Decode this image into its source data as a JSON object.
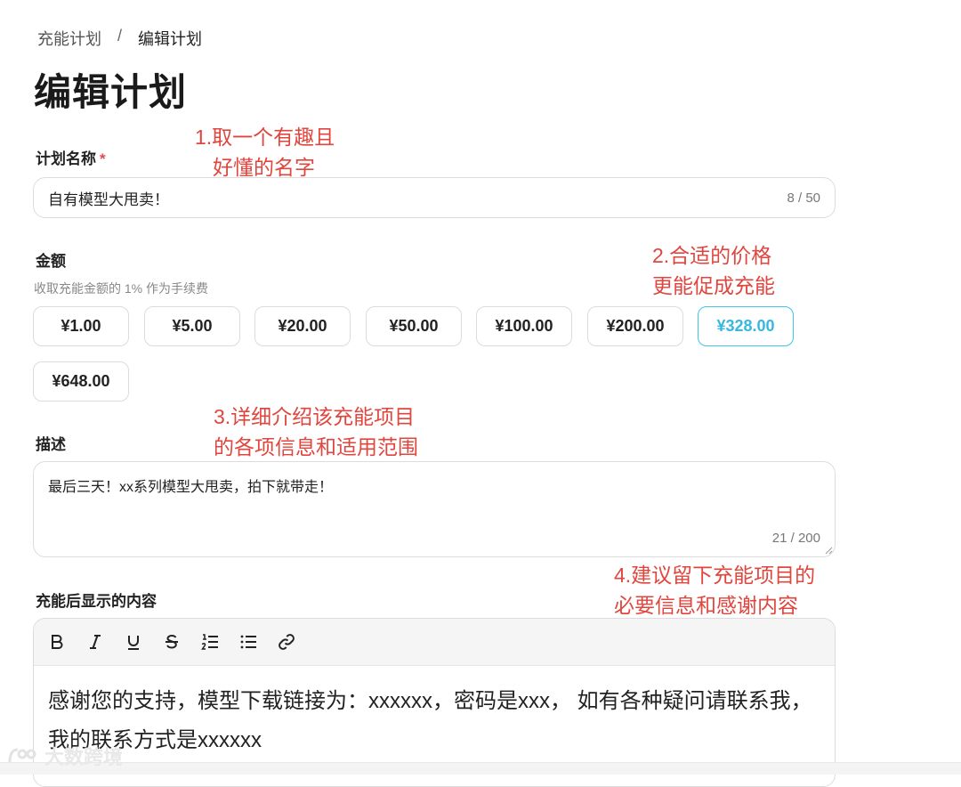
{
  "breadcrumb": {
    "parent": "充能计划",
    "separator": "/",
    "current": "编辑计划"
  },
  "page_title": "编辑计划",
  "plan_name": {
    "label": "计划名称",
    "required_mark": "*",
    "value": "自有模型大甩卖！",
    "counter": "8 / 50"
  },
  "amount": {
    "label": "金额",
    "hint": "收取充能金额的 1% 作为手续费",
    "options": [
      "¥1.00",
      "¥5.00",
      "¥20.00",
      "¥50.00",
      "¥100.00",
      "¥200.00",
      "¥328.00",
      "¥648.00"
    ],
    "selected": "¥328.00",
    "accent_color": "#37b8e0"
  },
  "description": {
    "label": "描述",
    "value": "最后三天！xx系列模型大甩卖，拍下就带走！",
    "counter": "21 / 200"
  },
  "post_content": {
    "label": "充能后显示的内容",
    "toolbar": [
      "bold-icon",
      "italic-icon",
      "underline-icon",
      "strikethrough-icon",
      "ordered-list-icon",
      "bullet-list-icon",
      "link-icon"
    ],
    "content": "感谢您的支持，模型下载链接为：xxxxxx，密码是xxx， 如有各种疑问请联系我，我的联系方式是xxxxxx"
  },
  "annotations": {
    "a1_line1": "1.取一个有趣且",
    "a1_line2": "好懂的名字",
    "a2_line1": "2.合适的价格",
    "a2_line2": "更能促成充能",
    "a3_line1": "3.详细介绍该充能项目",
    "a3_line2": "的各项信息和适用范围",
    "a4_line1": "4.建议留下充能项目的",
    "a4_line2": "必要信息和感谢内容",
    "color": "#e0463e"
  },
  "watermark": "大数跨境"
}
